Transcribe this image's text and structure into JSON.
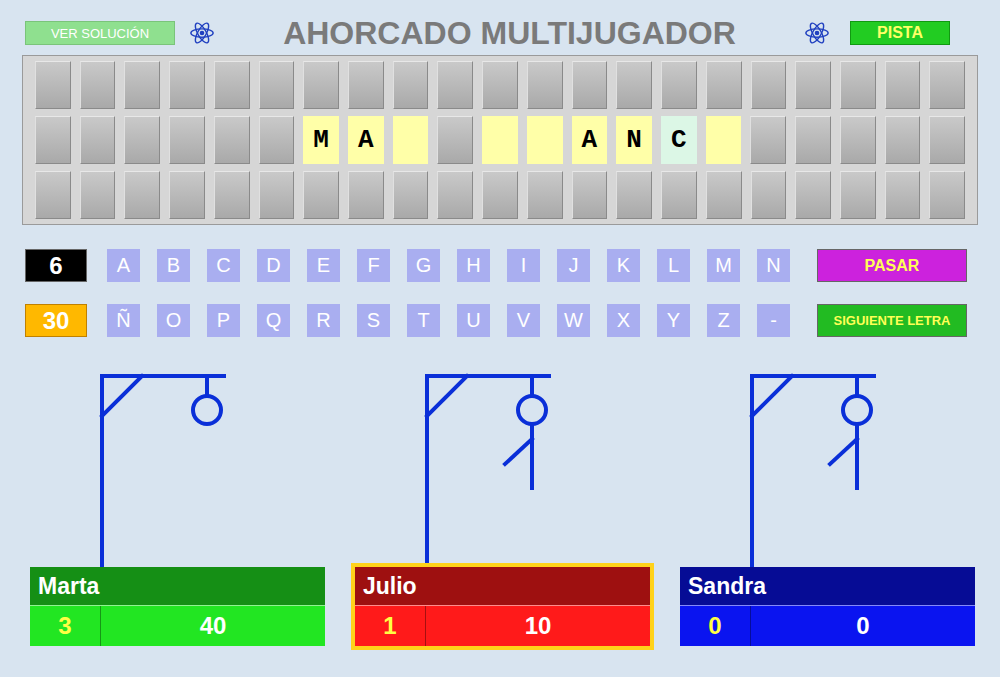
{
  "header": {
    "solution_button": "VER SOLUCIÓN",
    "title": "AHORCADO MULTIJUGADOR",
    "hint_button": "PISTA"
  },
  "board": {
    "rows": [
      [
        {
          "kind": "off",
          "text": ""
        },
        {
          "kind": "off",
          "text": ""
        },
        {
          "kind": "off",
          "text": ""
        },
        {
          "kind": "off",
          "text": ""
        },
        {
          "kind": "off",
          "text": ""
        },
        {
          "kind": "off",
          "text": ""
        },
        {
          "kind": "off",
          "text": ""
        },
        {
          "kind": "off",
          "text": ""
        },
        {
          "kind": "off",
          "text": ""
        },
        {
          "kind": "off",
          "text": ""
        },
        {
          "kind": "off",
          "text": ""
        },
        {
          "kind": "off",
          "text": ""
        },
        {
          "kind": "off",
          "text": ""
        },
        {
          "kind": "off",
          "text": ""
        },
        {
          "kind": "off",
          "text": ""
        },
        {
          "kind": "off",
          "text": ""
        },
        {
          "kind": "off",
          "text": ""
        },
        {
          "kind": "off",
          "text": ""
        },
        {
          "kind": "off",
          "text": ""
        },
        {
          "kind": "off",
          "text": ""
        },
        {
          "kind": "off",
          "text": ""
        }
      ],
      [
        {
          "kind": "off",
          "text": ""
        },
        {
          "kind": "off",
          "text": ""
        },
        {
          "kind": "off",
          "text": ""
        },
        {
          "kind": "off",
          "text": ""
        },
        {
          "kind": "off",
          "text": ""
        },
        {
          "kind": "off",
          "text": ""
        },
        {
          "kind": "letter",
          "text": "M"
        },
        {
          "kind": "letter",
          "text": "A"
        },
        {
          "kind": "letter",
          "text": ""
        },
        {
          "kind": "off",
          "text": ""
        },
        {
          "kind": "letter",
          "text": ""
        },
        {
          "kind": "letter",
          "text": ""
        },
        {
          "kind": "letter",
          "text": "A"
        },
        {
          "kind": "letter",
          "text": "N"
        },
        {
          "kind": "new",
          "text": "C"
        },
        {
          "kind": "letter",
          "text": ""
        },
        {
          "kind": "off",
          "text": ""
        },
        {
          "kind": "off",
          "text": ""
        },
        {
          "kind": "off",
          "text": ""
        },
        {
          "kind": "off",
          "text": ""
        },
        {
          "kind": "off",
          "text": ""
        }
      ],
      [
        {
          "kind": "off",
          "text": ""
        },
        {
          "kind": "off",
          "text": ""
        },
        {
          "kind": "off",
          "text": ""
        },
        {
          "kind": "off",
          "text": ""
        },
        {
          "kind": "off",
          "text": ""
        },
        {
          "kind": "off",
          "text": ""
        },
        {
          "kind": "off",
          "text": ""
        },
        {
          "kind": "off",
          "text": ""
        },
        {
          "kind": "off",
          "text": ""
        },
        {
          "kind": "off",
          "text": ""
        },
        {
          "kind": "off",
          "text": ""
        },
        {
          "kind": "off",
          "text": ""
        },
        {
          "kind": "off",
          "text": ""
        },
        {
          "kind": "off",
          "text": ""
        },
        {
          "kind": "off",
          "text": ""
        },
        {
          "kind": "off",
          "text": ""
        },
        {
          "kind": "off",
          "text": ""
        },
        {
          "kind": "off",
          "text": ""
        },
        {
          "kind": "off",
          "text": ""
        },
        {
          "kind": "off",
          "text": ""
        },
        {
          "kind": "off",
          "text": ""
        }
      ]
    ]
  },
  "counters": {
    "count": "6",
    "timer": "30"
  },
  "keyboard": {
    "rows": [
      [
        "A",
        "B",
        "C",
        "D",
        "E",
        "F",
        "G",
        "H",
        "I",
        "J",
        "K",
        "L",
        "M",
        "N"
      ],
      [
        "Ñ",
        "O",
        "P",
        "Q",
        "R",
        "S",
        "T",
        "U",
        "V",
        "W",
        "X",
        "Y",
        "Z",
        "-"
      ]
    ]
  },
  "actions": {
    "pass": "PASAR",
    "next_letter": "SIGUIENTE LETRA"
  },
  "players": [
    {
      "name": "Marta",
      "score": "3",
      "points": "40",
      "color": "#22e622",
      "selected": false,
      "gallows": {
        "head": true,
        "body": false,
        "left_arm": false,
        "right_arm": false,
        "left_leg": false,
        "right_leg": false
      }
    },
    {
      "name": "Julio",
      "score": "1",
      "points": "10",
      "color": "#ff1a1a",
      "selected": true,
      "gallows": {
        "head": true,
        "body": true,
        "left_arm": true,
        "right_arm": false,
        "left_leg": false,
        "right_leg": false
      }
    },
    {
      "name": "Sandra",
      "score": "0",
      "points": "0",
      "color": "#0a14f0",
      "selected": false,
      "gallows": {
        "head": true,
        "body": true,
        "left_arm": true,
        "right_arm": false,
        "left_leg": false,
        "right_leg": false
      }
    }
  ]
}
